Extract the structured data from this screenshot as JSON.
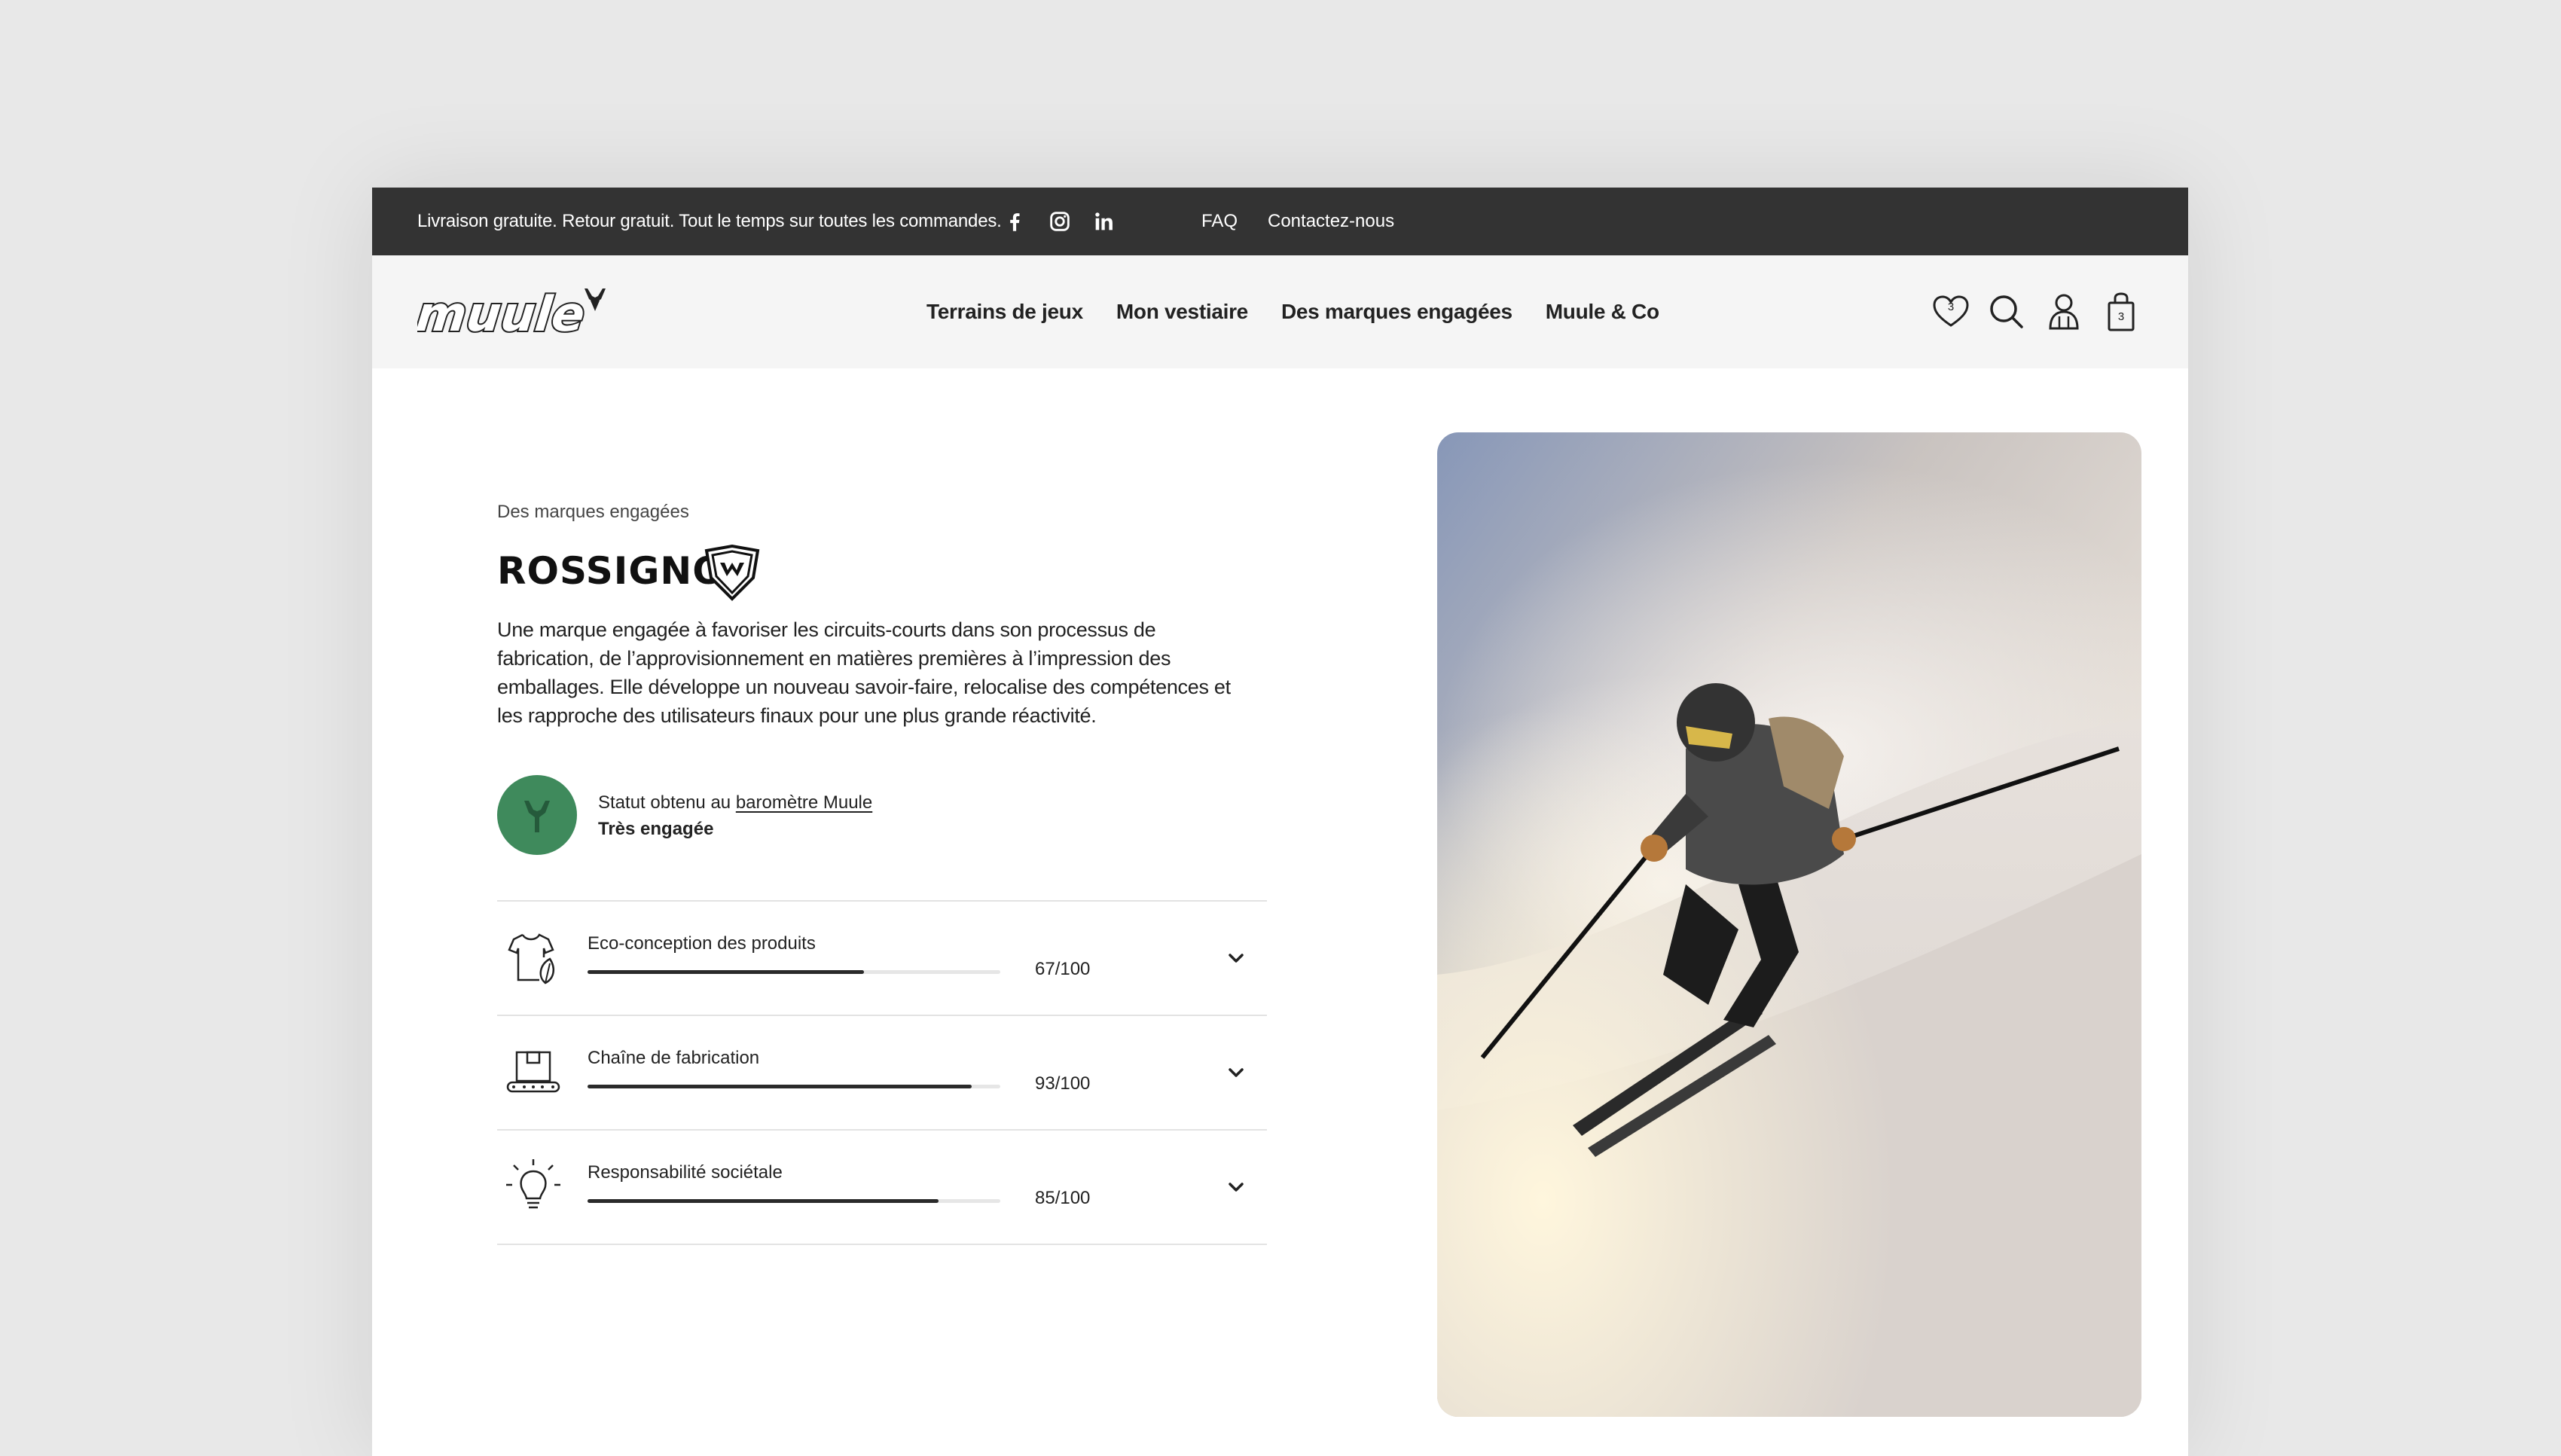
{
  "topbar": {
    "promo": "Livraison gratuite. Retour gratuit. Tout le temps sur toutes les commandes.",
    "social": [
      "facebook-icon",
      "instagram-icon",
      "linkedin-icon"
    ],
    "faq": "FAQ",
    "contact": "Contactez-nous"
  },
  "nav": {
    "logo": "muule",
    "items": [
      "Terrains de jeux",
      "Mon vestiaire",
      "Des marques engagées",
      "Muule & Co"
    ],
    "wishlist_count": "3",
    "cart_count": "3",
    "icons": [
      "heart-icon",
      "search-icon",
      "account-icon",
      "bag-icon"
    ]
  },
  "brand": {
    "eyebrow": "Des marques engagées",
    "name": "ROSSIGNOL",
    "description": "Une marque engagée à favoriser les circuits-courts dans son processus de fabrication, de l’approvisionnement en matières premières à l’impression des emballages. Elle développe un nouveau savoir-faire, relocalise des compétences et les rapproche des utilisateurs finaux pour une plus grande réactivité.",
    "status_prefix": "Statut obtenu au ",
    "status_link": "baromètre Muule",
    "status_value": "Très engagée",
    "status_color": "#3f8a5c"
  },
  "criteria": [
    {
      "label": "Eco-conception des produits",
      "score": "67/100",
      "value": 67,
      "icon": "eco-tshirt-icon"
    },
    {
      "label": "Chaîne de fabrication",
      "score": "93/100",
      "value": 93,
      "icon": "factory-box-icon"
    },
    {
      "label": "Responsabilité sociétale",
      "score": "85/100",
      "value": 85,
      "icon": "lightbulb-icon"
    }
  ]
}
